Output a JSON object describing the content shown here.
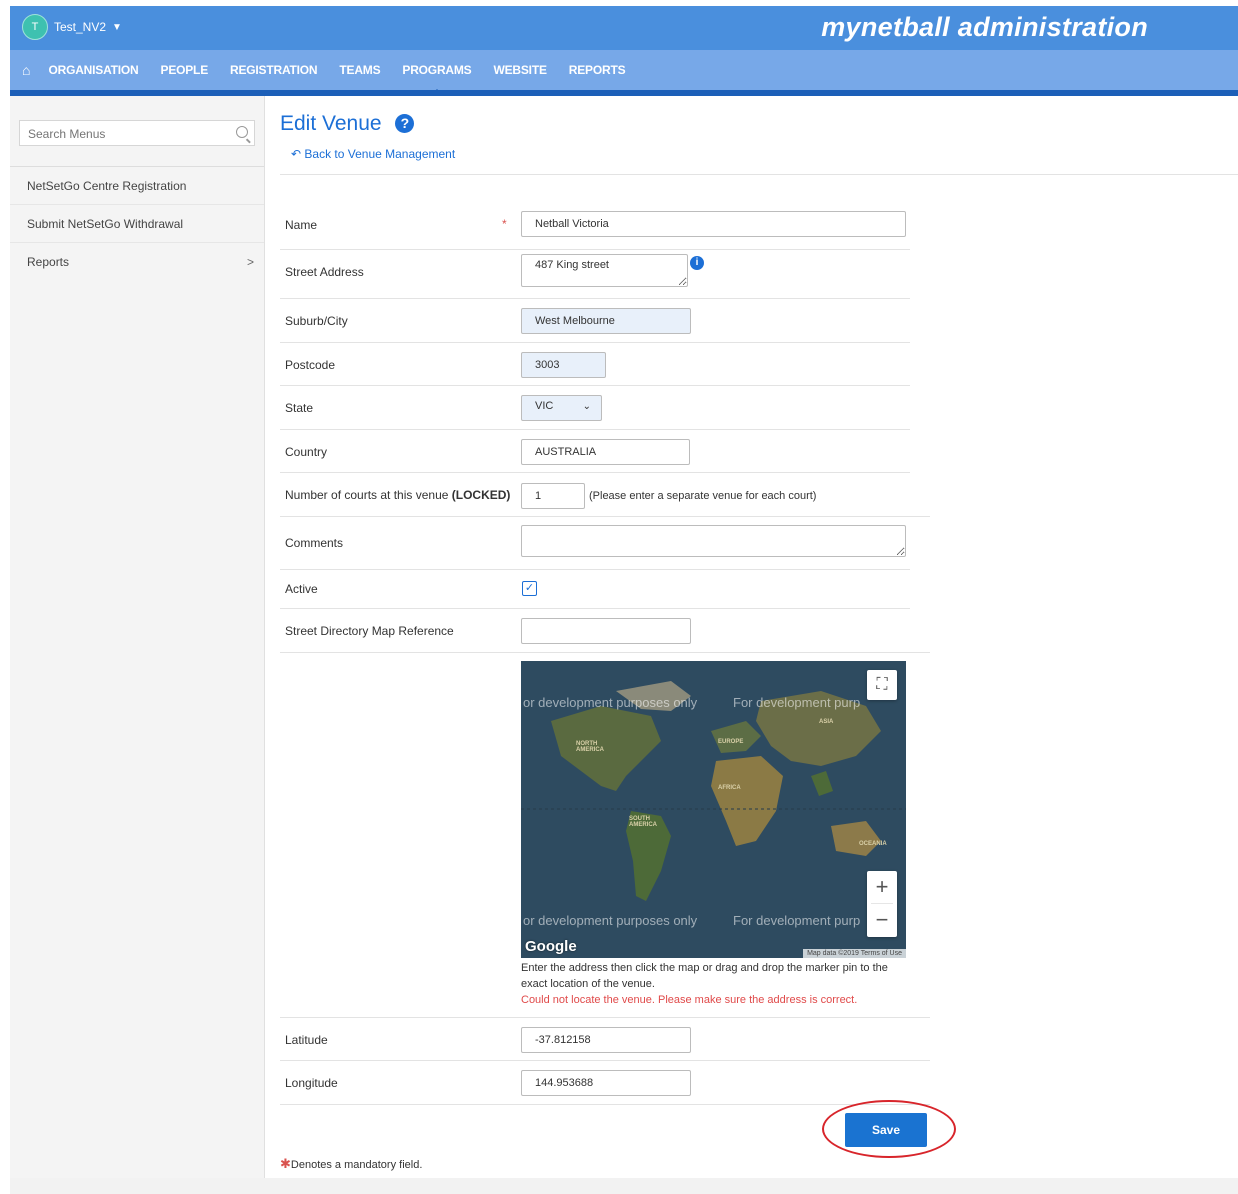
{
  "header": {
    "account_initial": "T",
    "account_name": "Test_NV2",
    "brand": "mynetball administration"
  },
  "nav": {
    "items": [
      "ORGANISATION",
      "PEOPLE",
      "REGISTRATION",
      "TEAMS",
      "PROGRAMS",
      "WEBSITE",
      "REPORTS"
    ],
    "active": "PROGRAMS"
  },
  "sidebar": {
    "search_placeholder": "Search Menus",
    "items": [
      {
        "label": "NetSetGo Centre Registration"
      },
      {
        "label": "Submit NetSetGo Withdrawal"
      },
      {
        "label": "Reports",
        "arrow": ">"
      }
    ]
  },
  "page": {
    "title": "Edit Venue",
    "help_icon": "?",
    "back_link": "Back to Venue Management"
  },
  "form": {
    "name_label": "Name",
    "name_value": "Netball Victoria",
    "street_label": "Street Address",
    "street_value": "487 King street",
    "suburb_label": "Suburb/City",
    "suburb_value": "West Melbourne",
    "postcode_label": "Postcode",
    "postcode_value": "3003",
    "state_label": "State",
    "state_value": "VIC",
    "country_label": "Country",
    "country_value": "AUSTRALIA",
    "courts_label": "Number of courts at this venue",
    "courts_locked": "(LOCKED)",
    "courts_value": "1",
    "courts_note": "(Please enter a separate venue for each court)",
    "comments_label": "Comments",
    "comments_value": "",
    "active_label": "Active",
    "active_checked": true,
    "mapref_label": "Street Directory Map Reference",
    "mapref_value": "",
    "latitude_label": "Latitude",
    "latitude_value": "-37.812158",
    "longitude_label": "Longitude",
    "longitude_value": "144.953688"
  },
  "map": {
    "watermark": "or development purposes only",
    "watermark2": "For development purp",
    "continents": {
      "north_america": "NORTH AMERICA",
      "south_america": "SOUTH AMERICA",
      "europe": "EUROPE",
      "africa": "AFRICA",
      "asia": "ASIA",
      "oceania": "OCEANIA"
    },
    "google": "Google",
    "attribution": "Map data ©2019   Terms of Use",
    "hint": "Enter the address then click the map or drag and drop the marker pin to the exact location of the venue.",
    "error": "Could not locate the venue. Please make sure the address is correct."
  },
  "save_label": "Save",
  "mandatory_note": "Denotes a mandatory field.",
  "colors": {
    "topbar": "#4a8fdd",
    "navbar": "#77a8e8",
    "accent": "#1c6fd6",
    "save": "#1a73d1",
    "error": "#e04a4a"
  }
}
